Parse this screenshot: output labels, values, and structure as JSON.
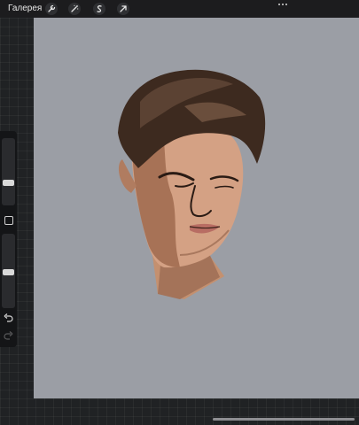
{
  "topbar": {
    "gallery_label": "Галерея",
    "tools": [
      {
        "name": "wrench-icon"
      },
      {
        "name": "magic-wand-icon"
      },
      {
        "name": "selection-icon"
      },
      {
        "name": "transform-arrow-icon"
      }
    ],
    "more_icon": "ellipsis-icon"
  },
  "sidebar": {
    "brush_size_level": 0.32,
    "opacity_level": 0.48,
    "modify_icon": "square-icon",
    "undo_icon": "undo-icon",
    "redo_icon": "redo-icon"
  },
  "canvas": {
    "background_color": "#9b9ea5",
    "artwork": "portrait-illustration"
  },
  "colors": {
    "ui_dark": "#1c1c1e",
    "hair": "#3d2a1f",
    "skin": "#d4a184"
  }
}
